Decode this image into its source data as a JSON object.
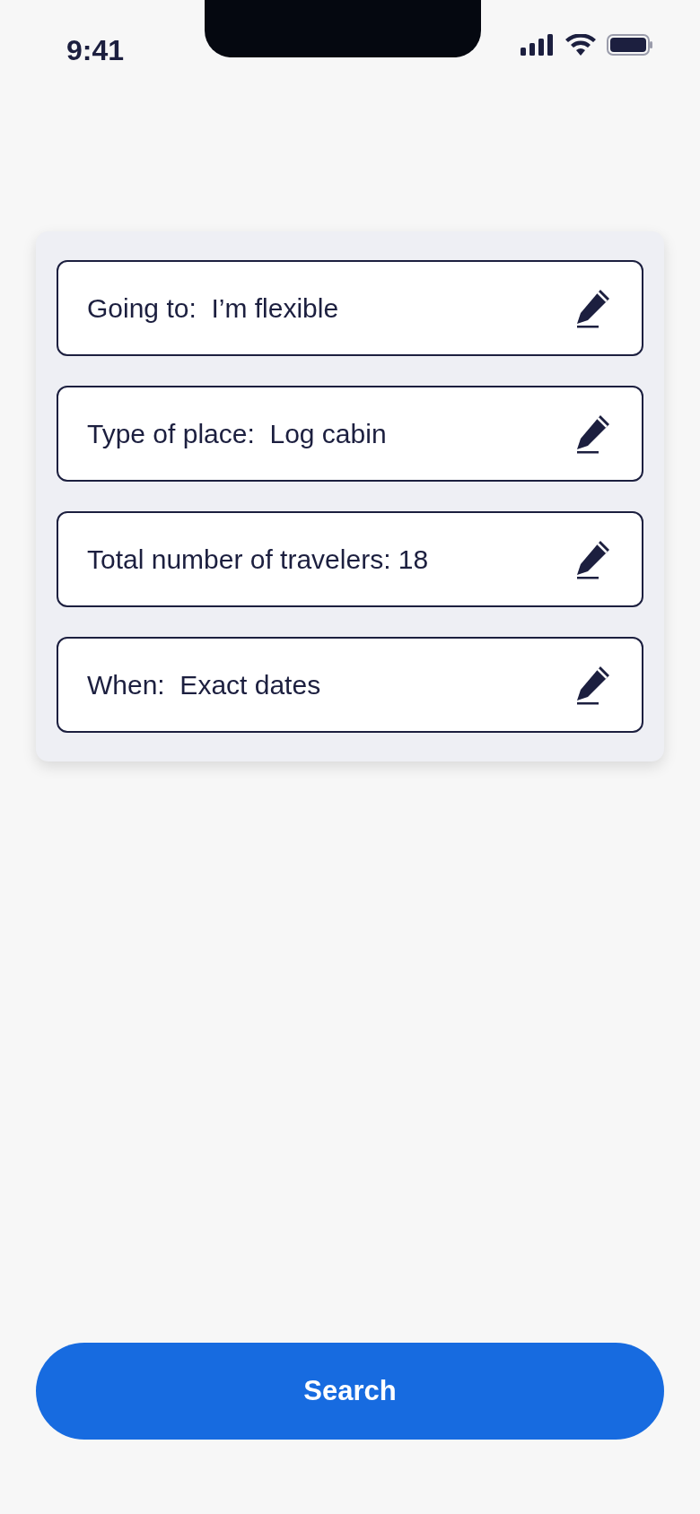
{
  "status_bar": {
    "time": "9:41"
  },
  "filters": [
    {
      "text": "Going to:  I’m flexible"
    },
    {
      "text": "Type of place:  Log cabin"
    },
    {
      "text": "Total number of travelers: 18"
    },
    {
      "text": "When:  Exact dates"
    }
  ],
  "search_button": {
    "label": "Search"
  }
}
